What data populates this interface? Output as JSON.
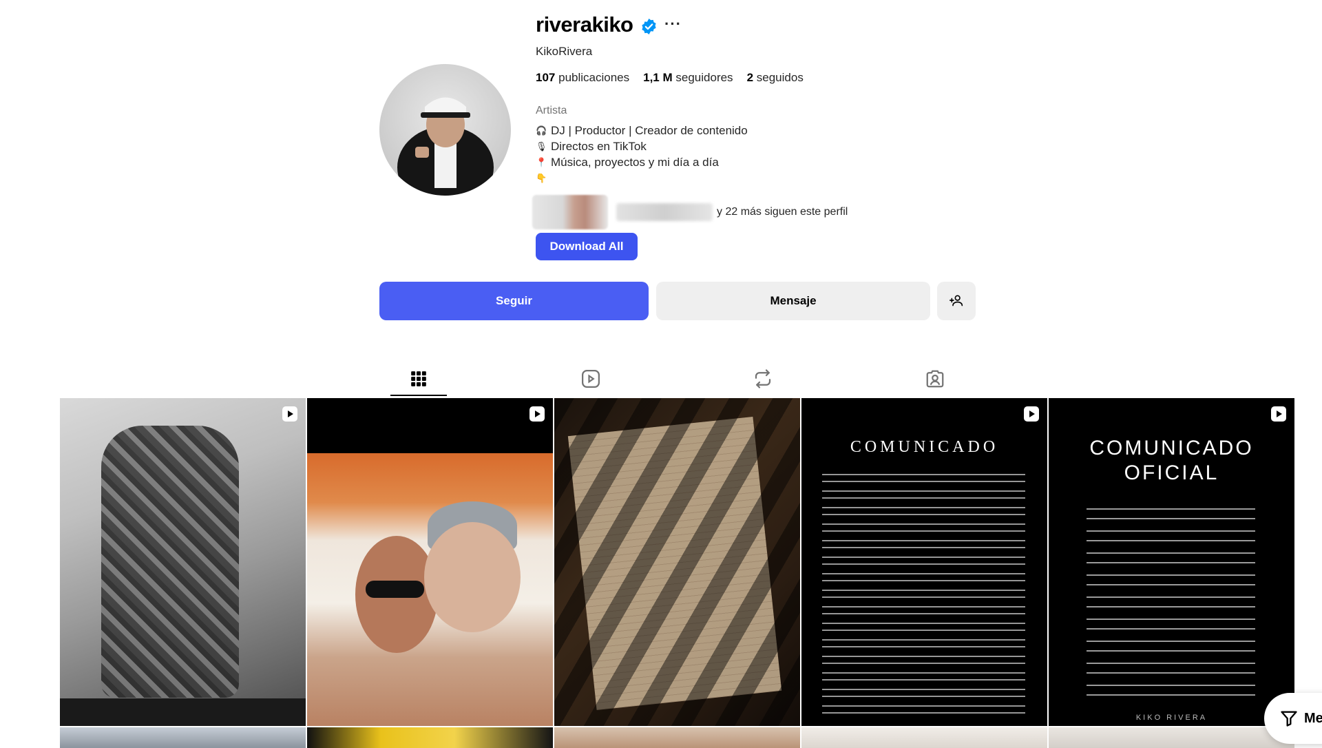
{
  "profile": {
    "username": "riverakiko",
    "full_name": "KikoRivera",
    "stats": [
      {
        "value": "107",
        "label": "publicaciones"
      },
      {
        "value": "1,1 M",
        "label": "seguidores"
      },
      {
        "value": "2",
        "label": "seguidos"
      }
    ],
    "category": "Artista",
    "bio": [
      {
        "icon": "headphones-icon",
        "text": "DJ | Productor | Creador de contenido"
      },
      {
        "icon": "microphone-icon",
        "text": "Directos en TikTok"
      },
      {
        "icon": "pin-icon",
        "text": "Música, proyectos y mi día a día"
      },
      {
        "icon": "pointing-down-icon",
        "text": ""
      }
    ],
    "followed_by_text": "y 22 más siguen este perfil"
  },
  "actions": {
    "download_all": "Download All",
    "follow": "Seguir",
    "message": "Mensaje"
  },
  "tabs": [
    {
      "icon": "grid-icon",
      "active": true
    },
    {
      "icon": "reels-icon",
      "active": false
    },
    {
      "icon": "reposts-icon",
      "active": false
    },
    {
      "icon": "tagged-icon",
      "active": false
    }
  ],
  "posts": [
    {
      "type": "reel",
      "text": ""
    },
    {
      "type": "reel",
      "text": ""
    },
    {
      "type": "image",
      "text": ""
    },
    {
      "type": "reel",
      "title": "COMUNICADO"
    },
    {
      "type": "reel",
      "title_line1": "COMUNICADO",
      "title_line2": "OFICIAL",
      "signature": "KIKO RIVERA"
    }
  ],
  "floating": {
    "filter_label": "Me"
  },
  "colors": {
    "primary_button": "#4a5ef3",
    "download_button": "#3d54f0",
    "verified": "#0095f6",
    "secondary_button": "#efefef"
  }
}
